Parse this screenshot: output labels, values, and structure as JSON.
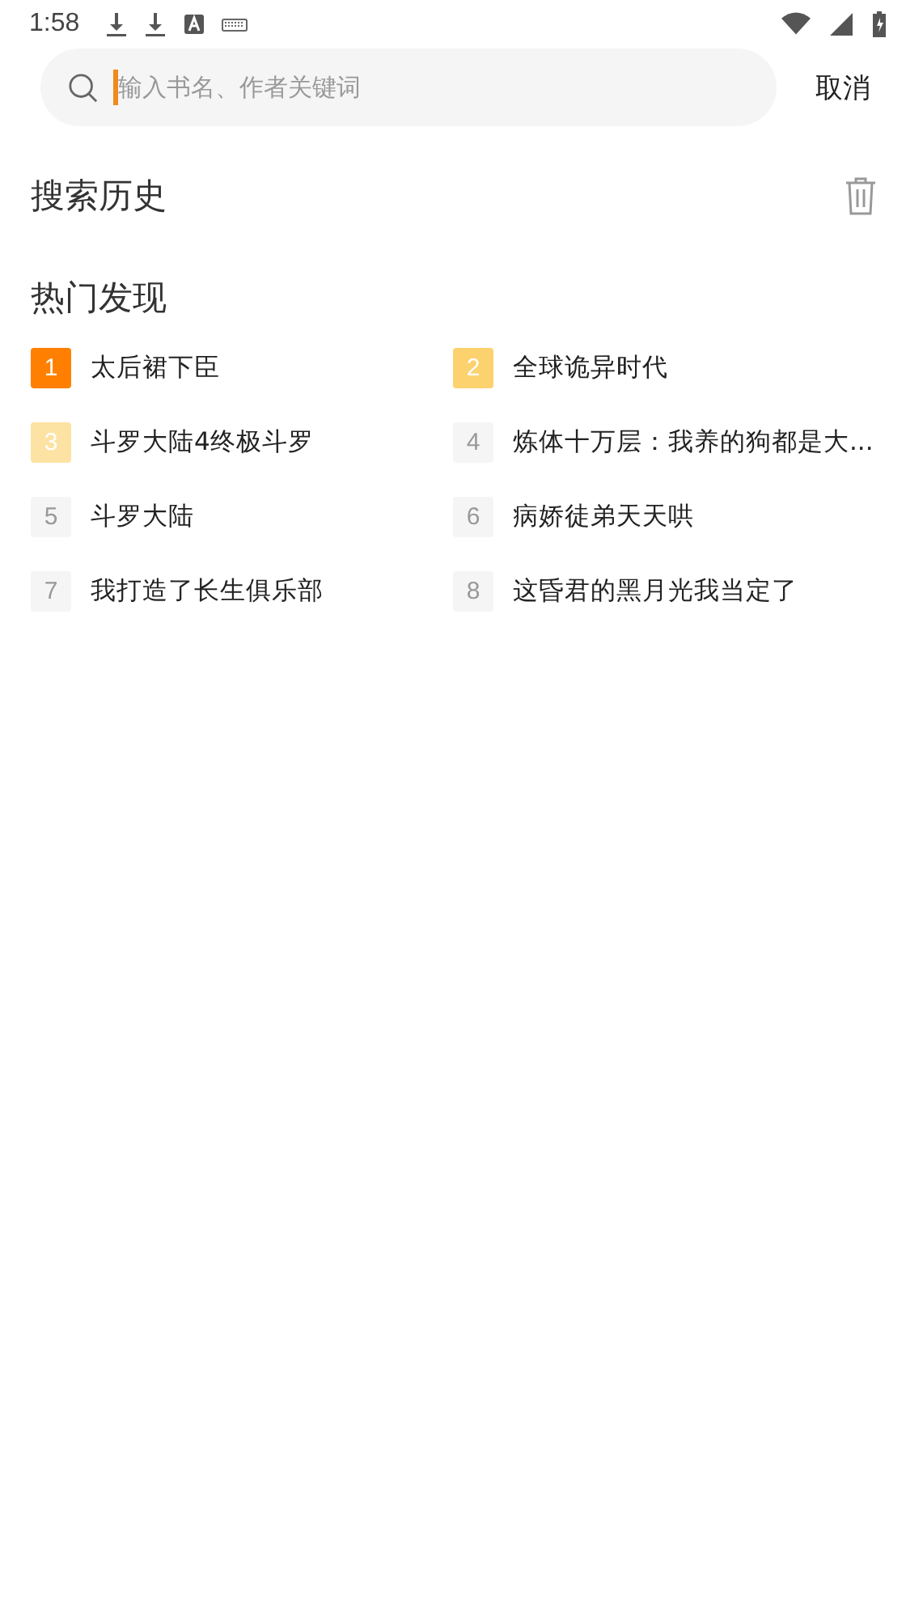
{
  "status_bar": {
    "time": "1:58"
  },
  "search": {
    "placeholder": "输入书名、作者关键词",
    "cancel": "取消"
  },
  "history": {
    "title": "搜索历史"
  },
  "hot": {
    "title": "热门发现",
    "items": [
      {
        "rank": "1",
        "title": "太后裙下臣",
        "color": "#ff8000"
      },
      {
        "rank": "2",
        "title": "全球诡异时代",
        "color": "#fcd26e"
      },
      {
        "rank": "3",
        "title": "斗罗大陆4终极斗罗",
        "color": "#fde3a3"
      },
      {
        "rank": "4",
        "title": "炼体十万层：我养的狗都是大...",
        "color": "#f5f5f5"
      },
      {
        "rank": "5",
        "title": "斗罗大陆",
        "color": "#f5f5f5"
      },
      {
        "rank": "6",
        "title": "病娇徒弟天天哄",
        "color": "#f5f5f5"
      },
      {
        "rank": "7",
        "title": "我打造了长生俱乐部",
        "color": "#f5f5f5"
      },
      {
        "rank": "8",
        "title": "这昏君的黑月光我当定了",
        "color": "#f5f5f5"
      }
    ]
  }
}
